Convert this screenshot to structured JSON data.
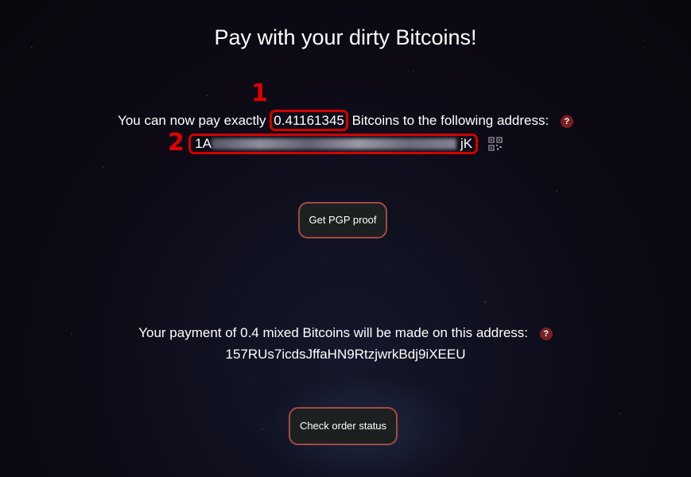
{
  "page": {
    "title": "Pay with your dirty Bitcoins!"
  },
  "payment": {
    "prefix": "You can now pay exactly",
    "amount": "0.41161345",
    "suffix": "Bitcoins to the following address:",
    "address_start": "1A",
    "address_end": "jK",
    "help": "?"
  },
  "annotations": {
    "marker_1": "1",
    "marker_2": "2",
    "color": "#d40000"
  },
  "buttons": {
    "pgp_label": "Get PGP proof",
    "status_label": "Check order status"
  },
  "mixed": {
    "text": "Your payment of 0.4 mixed Bitcoins will be made on this address:",
    "address": "157RUs7icdsJffaHN9RtzjwrkBdj9iXEEU",
    "help": "?"
  },
  "icons": {
    "help": "question-circle-icon",
    "qr": "qr-code-icon"
  },
  "colors": {
    "button_border": "#a24a45",
    "help_badge": "#7a1f22"
  }
}
